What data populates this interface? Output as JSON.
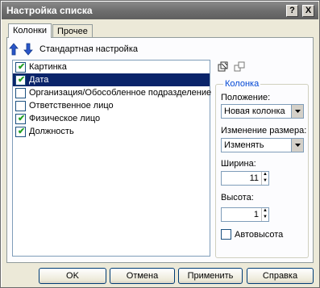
{
  "window": {
    "title": "Настройка списка",
    "help_btn": "?",
    "close_btn": "X"
  },
  "tabs": [
    {
      "label": "Колонки",
      "active": true
    },
    {
      "label": "Прочее",
      "active": false
    }
  ],
  "toolbar": {
    "standard_label": "Стандартная настройка"
  },
  "columns": [
    {
      "label": "Картинка",
      "checked": true,
      "selected": false
    },
    {
      "label": "Дата",
      "checked": true,
      "selected": true
    },
    {
      "label": "Организация/Обособленное подразделение",
      "checked": false,
      "selected": false
    },
    {
      "label": "Ответственное лицо",
      "checked": false,
      "selected": false
    },
    {
      "label": "Физическое лицо",
      "checked": true,
      "selected": false
    },
    {
      "label": "Должность",
      "checked": true,
      "selected": false
    }
  ],
  "column_group": {
    "title": "Колонка",
    "position_label": "Положение:",
    "position_value": "Новая колонка",
    "resize_label": "Изменение размера:",
    "resize_value": "Изменять",
    "width_label": "Ширина:",
    "width_value": "11",
    "height_label": "Высота:",
    "height_value": "1",
    "autoheight_label": "Автовысота"
  },
  "buttons": {
    "ok": "OK",
    "cancel": "Отмена",
    "apply": "Применить",
    "help": "Справка"
  }
}
